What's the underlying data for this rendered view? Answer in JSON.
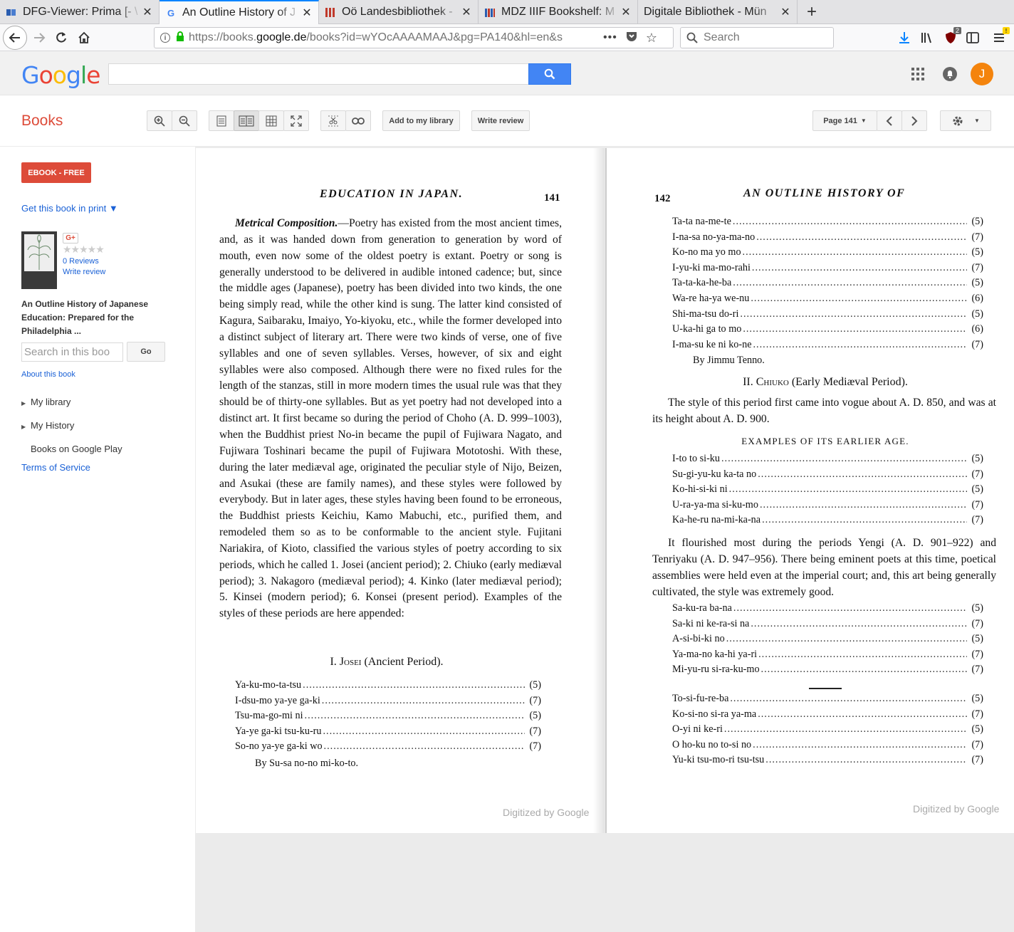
{
  "browser": {
    "tabs": [
      {
        "label": "DFG-Viewer: Prima [- \\",
        "favicon": "book-icon",
        "active": false
      },
      {
        "label": "An Outline History of J",
        "favicon": "google-g-icon",
        "active": true
      },
      {
        "label": "Oö Landesbibliothek - ",
        "favicon": "library-bars-icon",
        "active": false
      },
      {
        "label": "MDZ IIIF Bookshelf: M",
        "favicon": "mdz-icon",
        "active": false
      },
      {
        "label": "Digitale Bibliothek - Mün",
        "favicon": "none",
        "active": false
      }
    ],
    "url_prefix": "https://books.",
    "url_domain": "google.de",
    "url_rest": "/books?id=wYOcAAAAMAAJ&pg=PA140&hl=en&s",
    "search_placeholder": "Search",
    "notification_count": "2"
  },
  "google": {
    "logo": [
      "G",
      "o",
      "o",
      "g",
      "l",
      "e"
    ],
    "logo_colors": [
      "#4285f4",
      "#ea4335",
      "#fbbc05",
      "#4285f4",
      "#34a853",
      "#ea4335"
    ],
    "avatar_letter": "J"
  },
  "toolbar": {
    "books_label": "Books",
    "add_library": "Add to my library",
    "write_review": "Write review",
    "page_select": "Page 141"
  },
  "sidebar": {
    "ebook_button": "EBOOK - FREE",
    "get_print": "Get this book in print ▼",
    "gplus": "G+",
    "stars": "★★★★★",
    "reviews": "0 Reviews",
    "write_review": "Write review",
    "book_title": "An Outline History of Japanese Education: Prepared for the Philadelphia ...",
    "search_placeholder": "Search in this boo",
    "go": "Go",
    "about": "About this book",
    "my_library": "My library",
    "my_history": "My History",
    "books_on_play": "Books on Google Play",
    "terms": "Terms of Service"
  },
  "page_left": {
    "running_head": "EDUCATION IN JAPAN.",
    "page_number": "141",
    "heading_italic": "Metrical Composition.",
    "paragraph": "—Poetry has existed from the most ancient times, and, as it was handed down from generation to generation by word of mouth, even now some of the oldest poetry is extant. Poetry or song is generally understood to be delivered in audible intoned cadence; but, since the middle ages (Japanese), poetry has been divided into two kinds, the one being simply read, while the other kind is sung. The latter kind consisted of Kagura, Saibaraku, Imaiyo, Yo-kiyoku, etc., while the former developed into a distinct subject of literary art. There were two kinds of verse, one of five syllables and one of seven syllables. Verses, however, of six and eight syllables were also composed. Although there were no fixed rules for the length of the stanzas, still in more modern times the usual rule was that they should be of thirty-one syllables. But as yet poetry had not developed into a distinct art. It first became so during the period of Choho (A. D. 999–1003), when the Buddhist priest No-in became the pupil of Fujiwara Nagato, and Fujiwara Toshinari became the pupil of Fujiwara Mototoshi. With these, during the later mediæval age, originated the peculiar style of Nijo, Beizen, and Asukai (these are family names), and these styles were followed by everybody. But in later ages, these styles having been found to be erroneous, the Buddhist priests Keichiu, Kamo Mabuchi, etc., purified them, and remodeled them so as to be conformable to the ancient style. Fujitani Nariakira, of Kioto, classified the various styles of poetry according to six periods, which he called 1. Josei (ancient period); 2. Chiuko (early mediæval period); 3. Nakagoro (mediæval period); 4. Kinko (later mediæval period); 5. Kinsei (modern period); 6. Konsei (present period). Examples of the styles of these periods are here appended:",
    "section_num": "I.",
    "section_name": "Josei",
    "section_sub": "(Ancient Period).",
    "poem": [
      {
        "text": "Ya-ku-mo-ta-tsu",
        "syll": "(5)"
      },
      {
        "text": "I-dsu-mo ya-ye ga-ki",
        "syll": "(7)"
      },
      {
        "text": "Tsu-ma-go-mi ni",
        "syll": "(5)"
      },
      {
        "text": "Ya-ye ga-ki tsu-ku-ru",
        "syll": "(7)"
      },
      {
        "text": "So-no ya-ye ga-ki wo",
        "syll": "(7)"
      }
    ],
    "attribution": "By Su-sa no-no mi-ko-to.",
    "digitized": "Digitized by Google"
  },
  "page_right": {
    "page_number": "142",
    "running_head": "AN OUTLINE HISTORY OF",
    "poem1": [
      {
        "text": "Ta-ta na-me-te",
        "syll": "(5)"
      },
      {
        "text": "I-na-sa no-ya-ma-no",
        "syll": "(7)"
      },
      {
        "text": "Ko-no ma yo mo",
        "syll": "(5)"
      },
      {
        "text": "I-yu-ki ma-mo-rahi",
        "syll": "(7)"
      },
      {
        "text": "Ta-ta-ka-he-ba",
        "syll": "(5)"
      },
      {
        "text": "Wa-re ha-ya we-nu",
        "syll": "(6)"
      },
      {
        "text": "Shi-ma-tsu do-ri",
        "syll": "(5)"
      },
      {
        "text": "U-ka-hi ga to mo",
        "syll": "(6)"
      },
      {
        "text": "I-ma-su ke ni ko-ne",
        "syll": "(7)"
      }
    ],
    "attribution1": "By Jimmu Tenno.",
    "section_num": "II.",
    "section_name": "Chiuko",
    "section_sub": "(Early Mediæval Period).",
    "para1": "The style of this period first came into vogue about A. D. 850, and was at its height about A. D. 900.",
    "examples_heading": "EXAMPLES OF ITS EARLIER AGE.",
    "poem2": [
      {
        "text": "I-to to si-ku",
        "syll": "(5)"
      },
      {
        "text": "Su-gi-yu-ku ka-ta no",
        "syll": "(7)"
      },
      {
        "text": "Ko-hi-si-ki ni",
        "syll": "(5)"
      },
      {
        "text": "U-ra-ya-ma si-ku-mo",
        "syll": "(7)"
      },
      {
        "text": "Ka-he-ru na-mi-ka-na",
        "syll": "(7)"
      }
    ],
    "para2": "It flourished most during the periods Yengi (A. D. 901–922) and Tenriyaku (A. D. 947–956). There being eminent poets at this time, poetical assemblies were held even at the imperial court; and, this art being generally cultivated, the style was extremely good.",
    "poem3": [
      {
        "text": "Sa-ku-ra ba-na",
        "syll": "(5)"
      },
      {
        "text": "Sa-ki ni ke-ra-si na",
        "syll": "(7)"
      },
      {
        "text": "A-si-bi-ki no",
        "syll": "(5)"
      },
      {
        "text": "Ya-ma-no ka-hi ya-ri",
        "syll": "(7)"
      },
      {
        "text": "Mi-yu-ru si-ra-ku-mo",
        "syll": "(7)"
      }
    ],
    "poem4": [
      {
        "text": "To-si-fu-re-ba",
        "syll": "(5)"
      },
      {
        "text": "Ko-si-no si-ra ya-ma",
        "syll": "(7)"
      },
      {
        "text": "O-yi ni ke-ri",
        "syll": "(5)"
      },
      {
        "text": "O ho-ku no to-si no",
        "syll": "(7)"
      },
      {
        "text": "Yu-ki tsu-mo-ri tsu-tsu",
        "syll": "(7)"
      }
    ],
    "digitized": "Digitized by Google"
  }
}
